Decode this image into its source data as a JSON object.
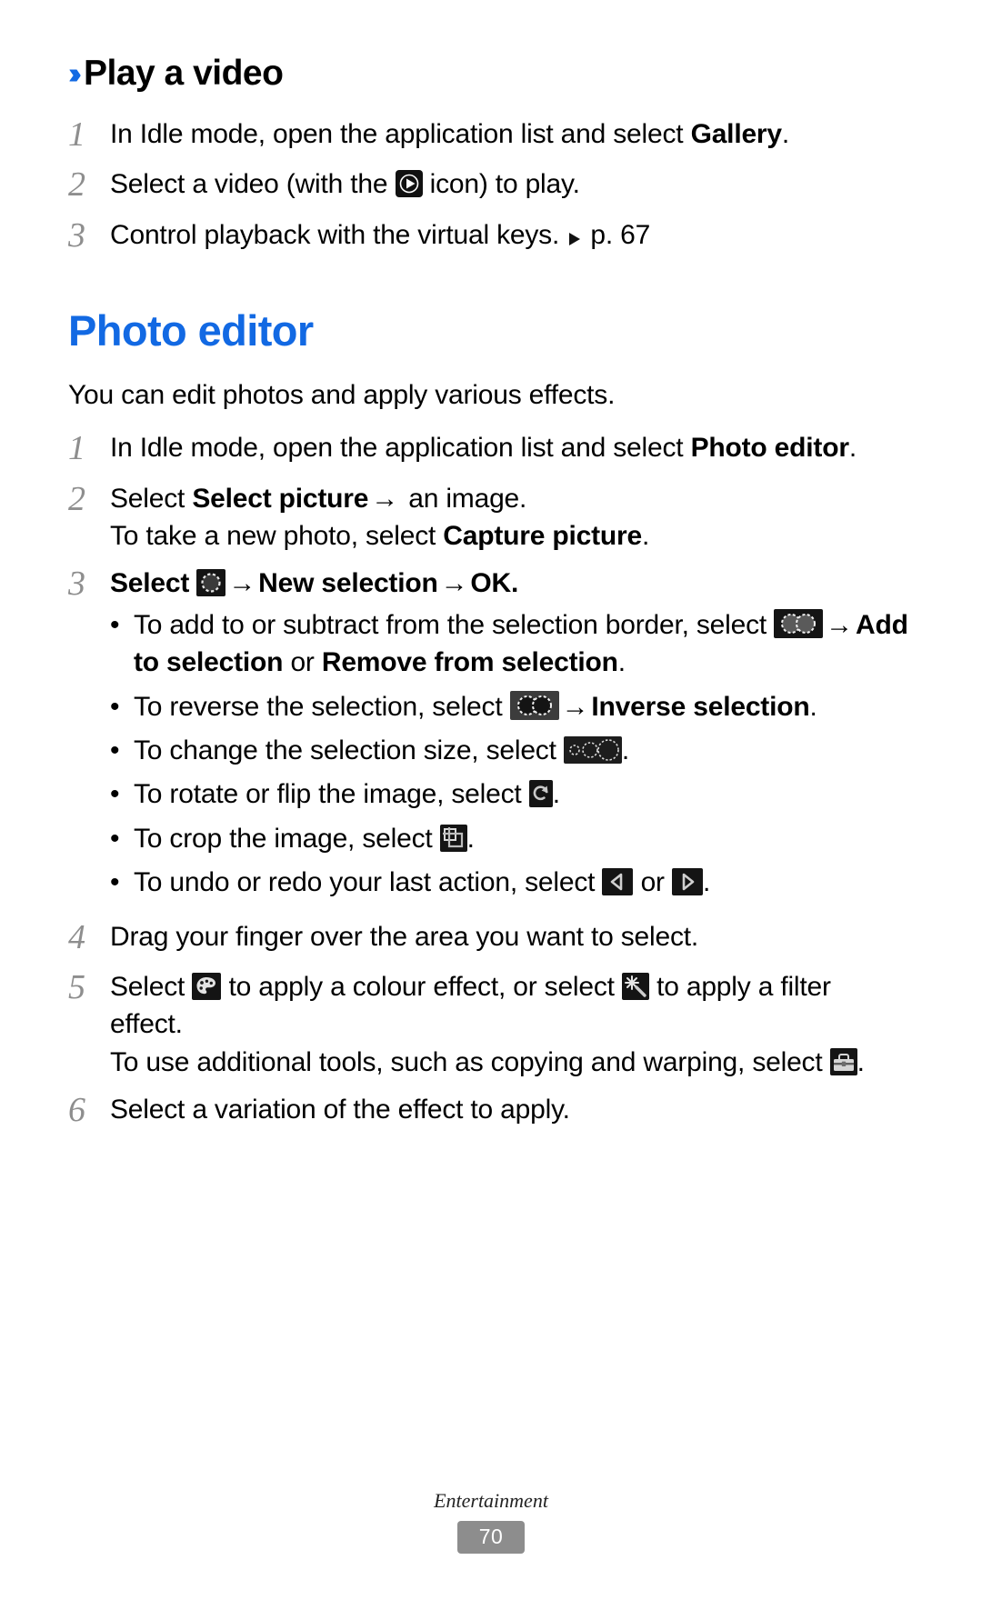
{
  "document": {
    "footer_label": "Entertainment",
    "page_number": "70"
  },
  "colors": {
    "accent_blue": "#1269e3",
    "step_number_gray": "#8e8e8e",
    "page_badge_gray": "#8d8d8d"
  },
  "sections": {
    "play_video": {
      "chevron": "››",
      "heading": "Play a video",
      "steps": [
        {
          "number": "1",
          "text_before": "In Idle mode, open the application list and select ",
          "bold": "Gallery",
          "text_after": "."
        },
        {
          "number": "2",
          "text_before": "Select a video (with the ",
          "icon": "play-icon",
          "text_after": " icon) to play."
        },
        {
          "number": "3",
          "text_before": "Control playback with the virtual keys. ",
          "icon": "triangle-right-icon",
          "text_after": " p. 67"
        }
      ]
    },
    "photo_editor": {
      "heading": "Photo editor",
      "intro": "You can edit photos and apply various effects.",
      "steps": [
        {
          "number": "1",
          "text_before": "In Idle mode, open the application list and select ",
          "bold": "Photo editor",
          "text_after": "."
        },
        {
          "number": "2",
          "line1_before": "Select ",
          "line1_bold": "Select picture",
          "line1_arrow": "→",
          "line1_after": " an image.",
          "line2_before": "To take a new photo, select ",
          "line2_bold": "Capture picture",
          "line2_after": "."
        },
        {
          "number": "3",
          "text_before": "Select ",
          "icon": "new-selection-icon",
          "arrow1": "→",
          "bold1": "New selection",
          "arrow2": "→",
          "bold2": "OK",
          "text_after": "."
        },
        {
          "number": "4",
          "text": "Drag your finger over the area you want to select."
        },
        {
          "number": "5",
          "line1_before": "Select ",
          "icon1": "palette-icon",
          "line1_mid": " to apply a colour effect, or select ",
          "icon2": "magic-filter-icon",
          "line1_after": " to apply a filter effect.",
          "line2_before": "To use additional tools, such as copying and warping, select ",
          "icon3": "toolbox-icon",
          "line2_after": "."
        },
        {
          "number": "6",
          "text": "Select a variation of the effect to apply."
        }
      ],
      "bullets": [
        {
          "dot": "•",
          "text_before": "To add to or subtract from the selection border, select ",
          "icon": "add-selection-icon",
          "arrow": "→",
          "bold1": "Add to selection",
          "mid": " or ",
          "bold2": "Remove from selection",
          "text_after": "."
        },
        {
          "dot": "•",
          "text_before": "To reverse the selection, select ",
          "icon": "inverse-selection-icon",
          "arrow": "→",
          "bold1": "Inverse selection",
          "text_after": "."
        },
        {
          "dot": "•",
          "text_before": "To change the selection size, select ",
          "icon": "selection-size-icon",
          "text_after": "."
        },
        {
          "dot": "•",
          "text_before": "To rotate or flip the image, select ",
          "icon": "rotate-icon",
          "text_after": "."
        },
        {
          "dot": "•",
          "text_before": "To crop the image, select ",
          "icon": "crop-icon",
          "text_after": "."
        },
        {
          "dot": "•",
          "text_before": "To undo or redo your last action, select ",
          "icon": "undo-icon",
          "mid": " or ",
          "icon2": "redo-icon",
          "text_after": "."
        }
      ]
    }
  }
}
